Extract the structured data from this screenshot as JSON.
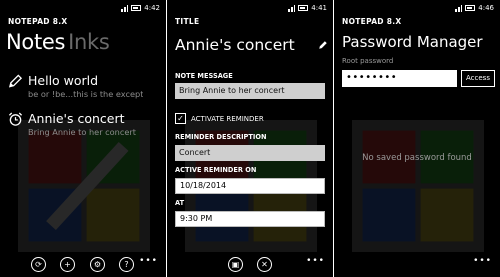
{
  "screens": {
    "notes": {
      "status_time": "4:42",
      "app_title": "NOTEPAD 8.X",
      "pivot_active": "Notes",
      "pivot_inactive": "Inks",
      "items": [
        {
          "title": "Hello world",
          "subtitle": "be or !be...this is the except",
          "icon": "pencil-icon"
        },
        {
          "title": "Annie's concert",
          "subtitle": "Bring Annie to her concert",
          "icon": "alarm-clock-icon"
        }
      ],
      "appbar": {
        "sync": "⟳",
        "add": "+",
        "settings": "⚙",
        "help": "?",
        "more": "•••"
      }
    },
    "editor": {
      "status_time": "4:41",
      "title_label": "TITLE",
      "title_value": "Annie's concert",
      "note_message_label": "NOTE MESSAGE",
      "note_message_value": "Bring Annie to her concert",
      "activate_reminder_label": "ACTIVATE REMINDER",
      "activate_reminder_checked": true,
      "reminder_description_label": "REMINDER DESCRIPTION",
      "reminder_description_value": "Concert",
      "active_reminder_on_label": "ACTIVE REMINDER ON",
      "date_value": "10/18/2014",
      "at_label": "AT",
      "time_value": "9:30 PM",
      "appbar": {
        "save": "▣",
        "cancel": "✕",
        "more": "•••"
      }
    },
    "passwords": {
      "status_time": "4:46",
      "app_title": "NOTEPAD 8.X",
      "title": "Password Manager",
      "root_password_label": "Root password",
      "password_value": "••••••••",
      "access_button": "Access",
      "empty_message": "No saved password found",
      "more": "•••"
    }
  },
  "colors": {
    "background": "#000000",
    "text": "#ffffff",
    "muted": "#8c8c8c",
    "inactive_pivot": "#6a6a6a",
    "field_light": "#cfcfcf"
  }
}
